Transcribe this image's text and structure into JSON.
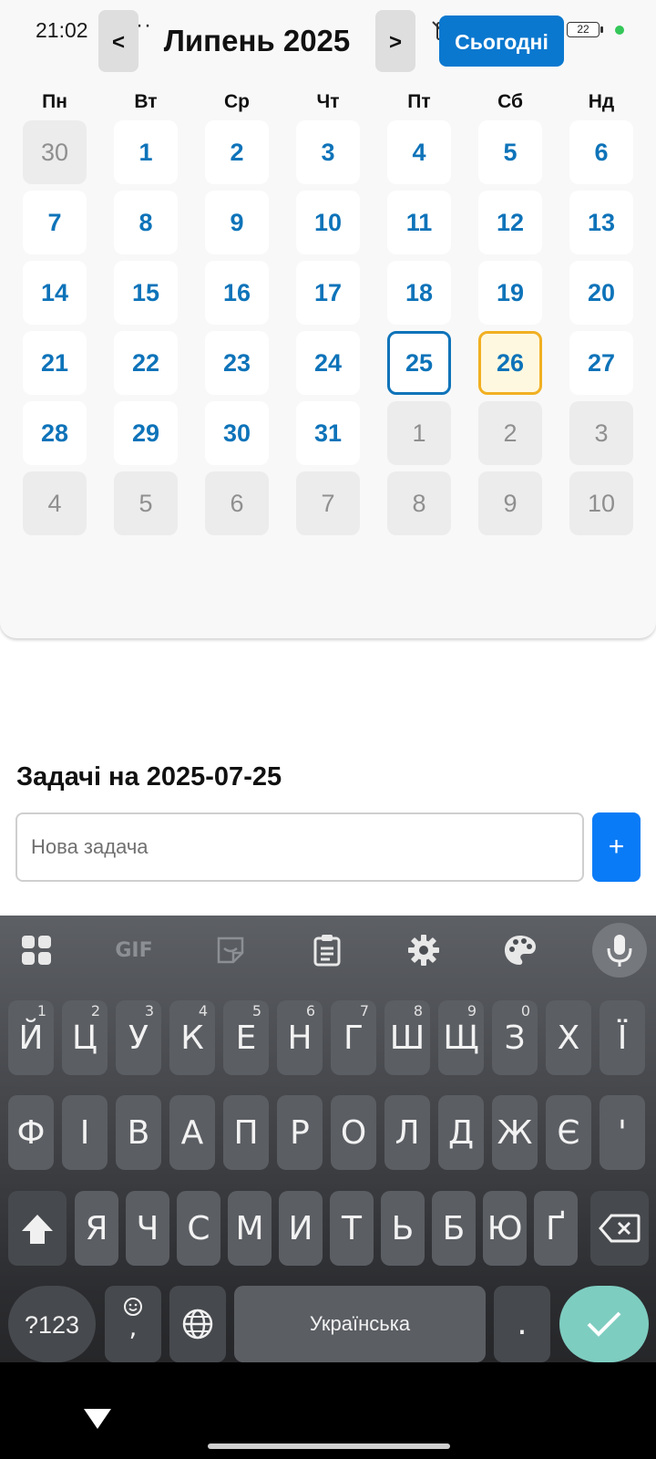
{
  "status_bar": {
    "time": "21:02",
    "dots": "···",
    "battery": "22"
  },
  "calendar": {
    "prev_label": "<",
    "next_label": ">",
    "month_title": "Липень 2025",
    "today_label": "Сьогодні",
    "weekdays": [
      "Пн",
      "Вт",
      "Ср",
      "Чт",
      "Пт",
      "Сб",
      "Нд"
    ],
    "weeks": [
      [
        {
          "d": "30",
          "s": "other"
        },
        {
          "d": "1",
          "s": "cur"
        },
        {
          "d": "2",
          "s": "cur"
        },
        {
          "d": "3",
          "s": "cur"
        },
        {
          "d": "4",
          "s": "cur"
        },
        {
          "d": "5",
          "s": "cur"
        },
        {
          "d": "6",
          "s": "cur"
        }
      ],
      [
        {
          "d": "7",
          "s": "cur"
        },
        {
          "d": "8",
          "s": "cur"
        },
        {
          "d": "9",
          "s": "cur"
        },
        {
          "d": "10",
          "s": "cur"
        },
        {
          "d": "11",
          "s": "cur"
        },
        {
          "d": "12",
          "s": "cur"
        },
        {
          "d": "13",
          "s": "cur"
        }
      ],
      [
        {
          "d": "14",
          "s": "cur"
        },
        {
          "d": "15",
          "s": "cur"
        },
        {
          "d": "16",
          "s": "cur"
        },
        {
          "d": "17",
          "s": "cur"
        },
        {
          "d": "18",
          "s": "cur"
        },
        {
          "d": "19",
          "s": "cur"
        },
        {
          "d": "20",
          "s": "cur"
        }
      ],
      [
        {
          "d": "21",
          "s": "cur"
        },
        {
          "d": "22",
          "s": "cur"
        },
        {
          "d": "23",
          "s": "cur"
        },
        {
          "d": "24",
          "s": "cur"
        },
        {
          "d": "25",
          "s": "selected"
        },
        {
          "d": "26",
          "s": "today"
        },
        {
          "d": "27",
          "s": "cur"
        }
      ],
      [
        {
          "d": "28",
          "s": "cur"
        },
        {
          "d": "29",
          "s": "cur"
        },
        {
          "d": "30",
          "s": "cur"
        },
        {
          "d": "31",
          "s": "cur"
        },
        {
          "d": "1",
          "s": "other"
        },
        {
          "d": "2",
          "s": "other"
        },
        {
          "d": "3",
          "s": "other"
        }
      ],
      [
        {
          "d": "4",
          "s": "other"
        },
        {
          "d": "5",
          "s": "other"
        },
        {
          "d": "6",
          "s": "other"
        },
        {
          "d": "7",
          "s": "other"
        },
        {
          "d": "8",
          "s": "other"
        },
        {
          "d": "9",
          "s": "other"
        },
        {
          "d": "10",
          "s": "other"
        }
      ]
    ]
  },
  "tasks": {
    "title": "Задачі на 2025-07-25",
    "input_placeholder": "Нова задача",
    "input_value": "",
    "add_label": "+"
  },
  "keyboard": {
    "toolbar": [
      "apps-grid-icon",
      "gif-icon",
      "sticker-icon",
      "clipboard-icon",
      "settings-gear-icon",
      "palette-icon",
      "microphone-icon"
    ],
    "gif_label": "GIF",
    "row1": [
      {
        "k": "Й",
        "h": "1"
      },
      {
        "k": "Ц",
        "h": "2"
      },
      {
        "k": "У",
        "h": "3"
      },
      {
        "k": "К",
        "h": "4"
      },
      {
        "k": "Е",
        "h": "5"
      },
      {
        "k": "Н",
        "h": "6"
      },
      {
        "k": "Г",
        "h": "7"
      },
      {
        "k": "Ш",
        "h": "8"
      },
      {
        "k": "Щ",
        "h": "9"
      },
      {
        "k": "З",
        "h": "0"
      },
      {
        "k": "Х",
        "h": ""
      },
      {
        "k": "Ї",
        "h": ""
      }
    ],
    "row2": [
      "Ф",
      "І",
      "В",
      "А",
      "П",
      "Р",
      "О",
      "Л",
      "Д",
      "Ж",
      "Є",
      "'"
    ],
    "row3": [
      "Я",
      "Ч",
      "С",
      "М",
      "И",
      "Т",
      "Ь",
      "Б",
      "Ю",
      "Ґ"
    ],
    "symbols_label": "?123",
    "emoji_comma_label": ",",
    "space_label": "Українська",
    "period_label": ".",
    "accent_color": "#7ecdc1"
  },
  "colors": {
    "primary_blue": "#0a78cf",
    "day_text": "#0e73b9",
    "today_border": "#f1b022",
    "add_button": "#0a7bf6"
  }
}
